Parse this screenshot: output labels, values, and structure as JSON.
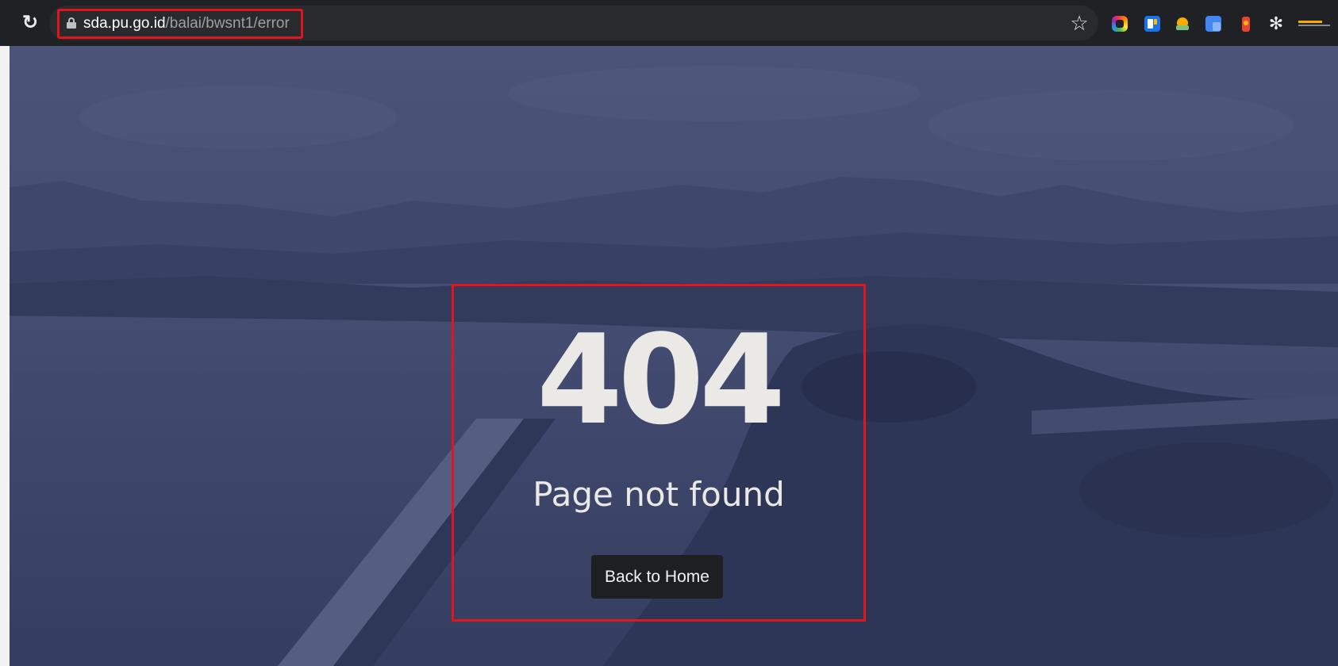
{
  "browser": {
    "reload_icon": "reload-icon",
    "url_host": "sda.pu.go.id",
    "url_path": "/balai/bwsnt1/error",
    "lock_icon": "lock-icon",
    "bookmark_icon": "star-icon",
    "extensions": [
      "color-square-extension-icon",
      "blue-note-extension-icon",
      "face-extension-icon",
      "translate-extension-icon",
      "red-figure-extension-icon",
      "puzzle-piece-icon",
      "brand-extension-icon"
    ]
  },
  "page": {
    "error_code": "404",
    "error_message": "Page not found",
    "home_button_label": "Back to Home",
    "highlight_color": "#e2141c",
    "text_color": "#ebe9e6",
    "overlay_color": "#3a4265",
    "button_color": "#1e1f21"
  }
}
